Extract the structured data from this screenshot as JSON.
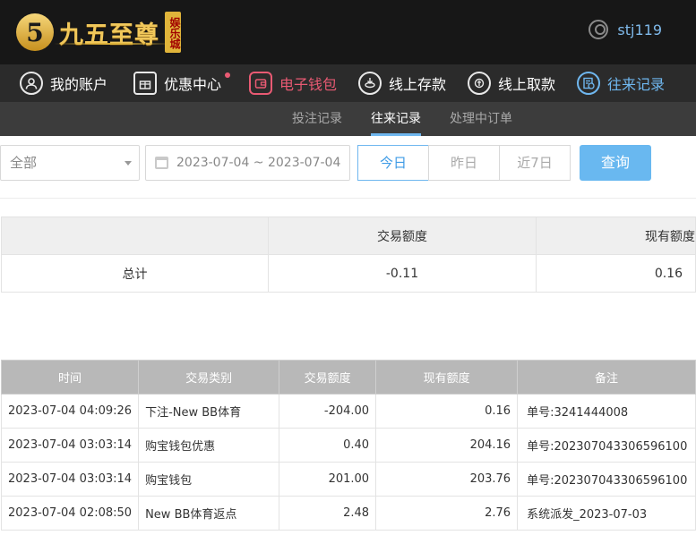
{
  "header": {
    "logo_mark": "5",
    "logo_text": "九五至尊",
    "logo_badge": "娱乐城",
    "username": "stj119"
  },
  "nav": {
    "items": [
      {
        "label": "我的账户",
        "icon": "user-icon"
      },
      {
        "label": "优惠中心",
        "icon": "gift-icon",
        "dot": true
      },
      {
        "label": "电子钱包",
        "icon": "wallet-icon",
        "active": true
      },
      {
        "label": "线上存款",
        "icon": "deposit-icon"
      },
      {
        "label": "线上取款",
        "icon": "withdraw-icon"
      },
      {
        "label": "往来记录",
        "icon": "records-icon"
      }
    ]
  },
  "subnav": {
    "tabs": [
      {
        "label": "投注记录"
      },
      {
        "label": "往来记录",
        "active": true
      },
      {
        "label": "处理中订单"
      }
    ]
  },
  "filter": {
    "type_value": "全部",
    "date_range": "2023-07-04 ~ 2023-07-04",
    "today": "今日",
    "yesterday": "昨日",
    "last7": "近7日",
    "query": "查询"
  },
  "summary": {
    "col_amount": "交易额度",
    "col_balance": "现有额度",
    "total_label": "总计",
    "total_amount": "-0.11",
    "total_balance": "0.16"
  },
  "detail": {
    "headers": [
      "时间",
      "交易类别",
      "交易额度",
      "现有额度",
      "备注"
    ],
    "rows": [
      {
        "time": "2023-07-04 04:09:26",
        "type": "下注-New BB体育",
        "amount": "-204.00",
        "balance": "0.16",
        "note": "单号:3241444008"
      },
      {
        "time": "2023-07-04 03:03:14",
        "type": "购宝钱包优惠",
        "amount": "0.40",
        "balance": "204.16",
        "note": "单号:202307043306596100"
      },
      {
        "time": "2023-07-04 03:03:14",
        "type": "购宝钱包",
        "amount": "201.00",
        "balance": "203.76",
        "note": "单号:202307043306596100"
      },
      {
        "time": "2023-07-04 02:08:50",
        "type": "New BB体育返点",
        "amount": "2.48",
        "balance": "2.76",
        "note": "系统派发_2023-07-03"
      }
    ]
  },
  "colors": {
    "accent_blue": "#69b8f0",
    "accent_red": "#e95a73",
    "gold": "#f0c75a"
  }
}
